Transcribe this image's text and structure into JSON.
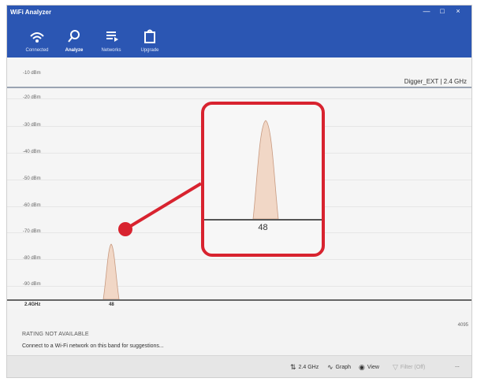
{
  "window": {
    "title": "WiFi Analyzer",
    "minimize": "—",
    "maximize": "□",
    "close": "×"
  },
  "nav": {
    "tabs": [
      {
        "label": "Connected",
        "icon": "wifi-icon",
        "active": false
      },
      {
        "label": "Analyze",
        "icon": "search-icon",
        "active": true
      },
      {
        "label": "Networks",
        "icon": "list-icon",
        "active": false
      },
      {
        "label": "Upgrade",
        "icon": "bag-icon",
        "active": false
      }
    ]
  },
  "chart": {
    "network_label": "Digger_EXT | 2.4 GHz",
    "y_labels": [
      "-10 dBm",
      "-20 dBm",
      "-30 dBm",
      "-40 dBm",
      "-50 dBm",
      "-60 dBm",
      "-70 dBm",
      "-80 dBm",
      "-90 dBm"
    ],
    "x_start_label": "2.4GHz",
    "channel_label": "48",
    "right_label": "4095"
  },
  "zoom": {
    "channel_label": "48",
    "border_color": "#d8232f"
  },
  "info": {
    "rating": "RATING NOT AVAILABLE",
    "suggestion": "Connect to a Wi-Fi network on this band for suggestions..."
  },
  "commands": {
    "band": "2.4 GHz",
    "graph": "Graph",
    "view": "View",
    "filter": "Filter (Off)",
    "more": "..."
  },
  "colors": {
    "accent": "#2b56b3",
    "highlight": "#d8232f",
    "signal_fill": "#f1d7c6"
  }
}
